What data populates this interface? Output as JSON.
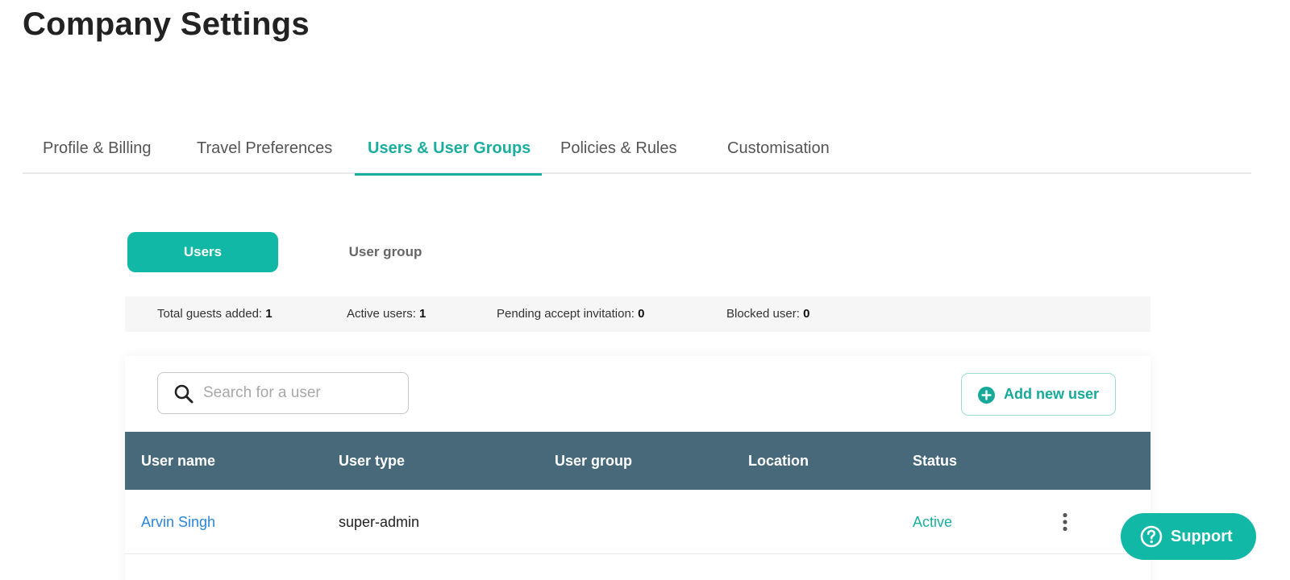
{
  "page": {
    "title": "Company Settings"
  },
  "tabs": [
    {
      "label": "Profile & Billing",
      "active": false
    },
    {
      "label": "Travel Preferences",
      "active": false
    },
    {
      "label": "Users & User Groups",
      "active": true
    },
    {
      "label": "Policies & Rules",
      "active": false
    },
    {
      "label": "Customisation",
      "active": false
    }
  ],
  "segment": {
    "users_label": "Users",
    "group_label": "User group",
    "selected": "Users"
  },
  "stats": [
    {
      "label": "Total guests added:",
      "value": "1"
    },
    {
      "label": "Active users:",
      "value": "1"
    },
    {
      "label": "Pending accept invitation:",
      "value": "0"
    },
    {
      "label": "Blocked user:",
      "value": "0"
    }
  ],
  "search": {
    "placeholder": "Search for a user",
    "value": "",
    "icon": "search-icon"
  },
  "add_user": {
    "label": "Add new user",
    "icon": "plus-circle-icon"
  },
  "table": {
    "columns": [
      "User name",
      "User type",
      "User group",
      "Location",
      "Status"
    ],
    "rows": [
      {
        "name": "Arvin Singh",
        "type": "super-admin",
        "group": "",
        "location": "",
        "status": "Active"
      }
    ]
  },
  "support": {
    "label": "Support",
    "icon": "question-circle-icon"
  },
  "colors": {
    "accent": "#12b8a6",
    "accent_text": "#1aae9f",
    "table_header": "#47697a",
    "link": "#2a86d8"
  }
}
